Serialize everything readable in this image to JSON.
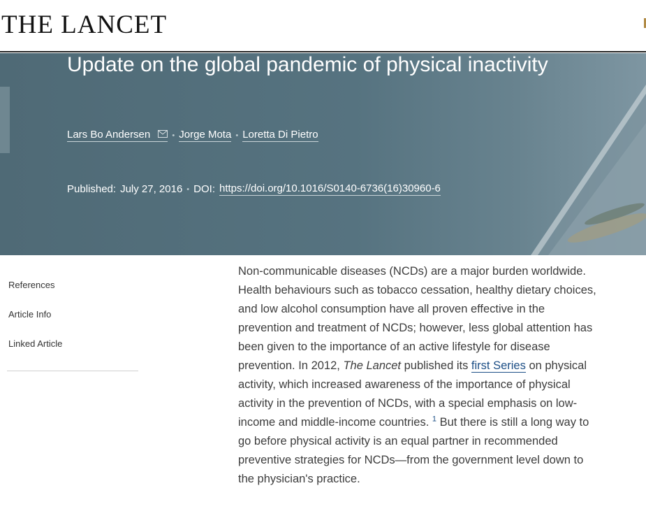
{
  "header": {
    "logo": "THE LANCET"
  },
  "banner": {
    "title": "Update on the global pandemic of physical inactivity",
    "authors": [
      "Lars Bo Andersen",
      "Jorge Mota",
      "Loretta Di Pietro"
    ],
    "published_label": "Published:",
    "published_date": "July 27, 2016",
    "doi_label": "DOI:",
    "doi_url": "https://doi.org/10.1016/S0140-6736(16)30960-6"
  },
  "sidebar": {
    "items": [
      {
        "label": "References"
      },
      {
        "label": "Article Info"
      },
      {
        "label": "Linked Article"
      }
    ]
  },
  "article": {
    "p1": "Non-communicable diseases (NCDs) are a major burden worldwide. Health behaviours such as tobacco cessation, healthy dietary choices, and low alcohol consumption have all proven effective in the prevention and treatment of NCDs; however, less global attention has been given to the importance of an active lifestyle for disease prevention. In 2012, ",
    "journal": "The Lancet",
    "p2": " published its ",
    "series_link": "first Series",
    "p3": " on physical activity, which increased awareness of the importance of physical activity in the prevention of NCDs, with a special emphasis on low-income and middle-income countries. ",
    "ref": "1",
    "p4": " But there is still a long way to go before physical activity is an equal partner in recommended preventive strategies for NCDs—from the government level down to the physician's practice."
  }
}
